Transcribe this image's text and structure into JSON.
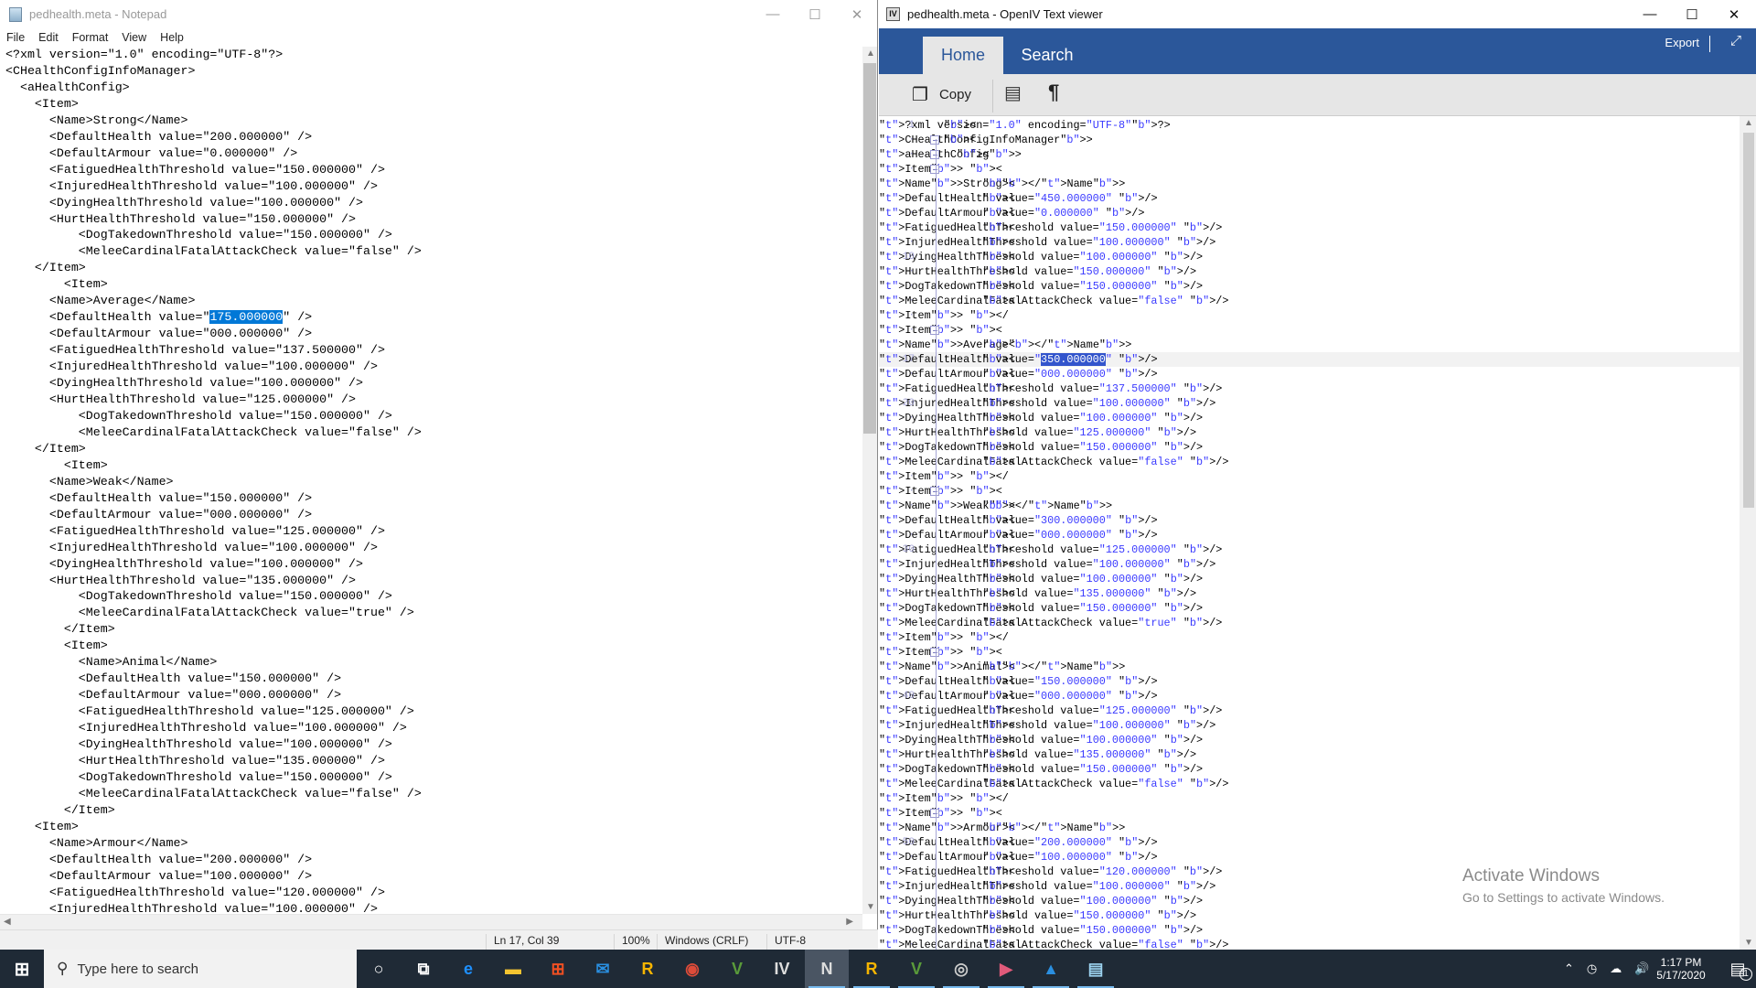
{
  "notepad": {
    "title": "pedhealth.meta - Notepad",
    "menu": [
      "File",
      "Edit",
      "Format",
      "View",
      "Help"
    ],
    "selection": {
      "line": 16,
      "text": "175.000000"
    },
    "lines": [
      "<?xml version=\"1.0\" encoding=\"UTF-8\"?>",
      "<CHealthConfigInfoManager>",
      "  <aHealthConfig>",
      "    <Item>",
      "      <Name>Strong</Name>",
      "      <DefaultHealth value=\"200.000000\" />",
      "      <DefaultArmour value=\"0.000000\" />",
      "      <FatiguedHealthThreshold value=\"150.000000\" />",
      "      <InjuredHealthThreshold value=\"100.000000\" />",
      "      <DyingHealthThreshold value=\"100.000000\" />",
      "      <HurtHealthThreshold value=\"150.000000\" />",
      "          <DogTakedownThreshold value=\"150.000000\" />",
      "          <MeleeCardinalFatalAttackCheck value=\"false\" />",
      "    </Item>",
      "        <Item>",
      "      <Name>Average</Name>",
      "      <DefaultHealth value=\"175.000000\" />",
      "      <DefaultArmour value=\"000.000000\" />",
      "      <FatiguedHealthThreshold value=\"137.500000\" />",
      "      <InjuredHealthThreshold value=\"100.000000\" />",
      "      <DyingHealthThreshold value=\"100.000000\" />",
      "      <HurtHealthThreshold value=\"125.000000\" />",
      "          <DogTakedownThreshold value=\"150.000000\" />",
      "          <MeleeCardinalFatalAttackCheck value=\"false\" />",
      "    </Item>",
      "        <Item>",
      "      <Name>Weak</Name>",
      "      <DefaultHealth value=\"150.000000\" />",
      "      <DefaultArmour value=\"000.000000\" />",
      "      <FatiguedHealthThreshold value=\"125.000000\" />",
      "      <InjuredHealthThreshold value=\"100.000000\" />",
      "      <DyingHealthThreshold value=\"100.000000\" />",
      "      <HurtHealthThreshold value=\"135.000000\" />",
      "          <DogTakedownThreshold value=\"150.000000\" />",
      "          <MeleeCardinalFatalAttackCheck value=\"true\" />",
      "        </Item>",
      "        <Item>",
      "          <Name>Animal</Name>",
      "          <DefaultHealth value=\"150.000000\" />",
      "          <DefaultArmour value=\"000.000000\" />",
      "          <FatiguedHealthThreshold value=\"125.000000\" />",
      "          <InjuredHealthThreshold value=\"100.000000\" />",
      "          <DyingHealthThreshold value=\"100.000000\" />",
      "          <HurtHealthThreshold value=\"135.000000\" />",
      "          <DogTakedownThreshold value=\"150.000000\" />",
      "          <MeleeCardinalFatalAttackCheck value=\"false\" />",
      "        </Item>",
      "    <Item>",
      "      <Name>Armour</Name>",
      "      <DefaultHealth value=\"200.000000\" />",
      "      <DefaultArmour value=\"100.000000\" />",
      "      <FatiguedHealthThreshold value=\"120.000000\" />",
      "      <InjuredHealthThreshold value=\"100.000000\" />"
    ],
    "status": {
      "position": "Ln 17, Col 39",
      "zoom": "100%",
      "line_ending": "Windows (CRLF)",
      "encoding": "UTF-8"
    }
  },
  "openiv": {
    "title": "pedhealth.meta - OpenIV Text viewer",
    "tabs": [
      "Home",
      "Search"
    ],
    "export_label": "Export",
    "toolbar": {
      "copy_label": "Copy"
    },
    "current_line": 17,
    "selection": {
      "line": 17,
      "text": "350.000000"
    },
    "fold_lines": [
      2,
      3,
      4,
      15,
      26,
      37,
      48
    ],
    "lines": [
      "<?xml version=\"1.0\" encoding=\"UTF-8\"?>",
      "<CHealthConfigInfoManager>",
      "  <aHealthConfig>",
      "    <Item>",
      "      <Name>Strong</Name>",
      "      <DefaultHealth value=\"450.000000\" />",
      "      <DefaultArmour value=\"0.000000\" />",
      "      <FatiguedHealthThreshold value=\"150.000000\" />",
      "      <InjuredHealthThreshold value=\"100.000000\" />",
      "      <DyingHealthThreshold value=\"100.000000\" />",
      "      <HurtHealthThreshold value=\"150.000000\" />",
      "      <DogTakedownThreshold value=\"150.000000\" />",
      "      <MeleeCardinalFatalAttackCheck value=\"false\" />",
      "    </Item>",
      "    <Item>",
      "      <Name>Average</Name>",
      "      <DefaultHealth value=\"350.000000\" />",
      "      <DefaultArmour value=\"000.000000\" />",
      "      <FatiguedHealthThreshold value=\"137.500000\" />",
      "      <InjuredHealthThreshold value=\"100.000000\" />",
      "      <DyingHealthThreshold value=\"100.000000\" />",
      "      <HurtHealthThreshold value=\"125.000000\" />",
      "      <DogTakedownThreshold value=\"150.000000\" />",
      "      <MeleeCardinalFatalAttackCheck value=\"false\" />",
      "    </Item>",
      "    <Item>",
      "      <Name>Weak</Name>",
      "      <DefaultHealth value=\"300.000000\" />",
      "      <DefaultArmour value=\"000.000000\" />",
      "      <FatiguedHealthThreshold value=\"125.000000\" />",
      "      <InjuredHealthThreshold value=\"100.000000\" />",
      "      <DyingHealthThreshold value=\"100.000000\" />",
      "      <HurtHealthThreshold value=\"135.000000\" />",
      "      <DogTakedownThreshold value=\"150.000000\" />",
      "      <MeleeCardinalFatalAttackCheck value=\"true\" />",
      "    </Item>",
      "    <Item>",
      "      <Name>Animal</Name>",
      "      <DefaultHealth value=\"150.000000\" />",
      "      <DefaultArmour value=\"000.000000\" />",
      "      <FatiguedHealthThreshold value=\"125.000000\" />",
      "      <InjuredHealthThreshold value=\"100.000000\" />",
      "      <DyingHealthThreshold value=\"100.000000\" />",
      "      <HurtHealthThreshold value=\"135.000000\" />",
      "      <DogTakedownThreshold value=\"150.000000\" />",
      "      <MeleeCardinalFatalAttackCheck value=\"false\" />",
      "    </Item>",
      "    <Item>",
      "      <Name>Armour</Name>",
      "      <DefaultHealth value=\"200.000000\" />",
      "      <DefaultArmour value=\"100.000000\" />",
      "      <FatiguedHealthThreshold value=\"120.000000\" />",
      "      <InjuredHealthThreshold value=\"100.000000\" />",
      "      <DyingHealthThreshold value=\"100.000000\" />",
      "      <HurtHealthThreshold value=\"150.000000\" />",
      "      <DogTakedownThreshold value=\"150.000000\" />",
      "      <MeleeCardinalFatalAttackCheck value=\"false\" />"
    ]
  },
  "watermark": {
    "title": "Activate Windows",
    "subtitle": "Go to Settings to activate Windows."
  },
  "taskbar": {
    "search_placeholder": "Type here to search",
    "apps": [
      "cortana",
      "task-view",
      "edge",
      "file-explorer",
      "store",
      "mail",
      "rockstar-launcher",
      "chrome",
      "gta-v",
      "openiv",
      "openiv-active",
      "rockstar",
      "gta-v-2",
      "obs",
      "video-editor",
      "photos",
      "notepad"
    ],
    "time": "1:17 PM",
    "date": "5/17/2020",
    "notification_count": "1"
  },
  "colors": {
    "ribbon": "#2b579a",
    "selection": "#0078d7",
    "taskbar": "#1f2a36"
  }
}
